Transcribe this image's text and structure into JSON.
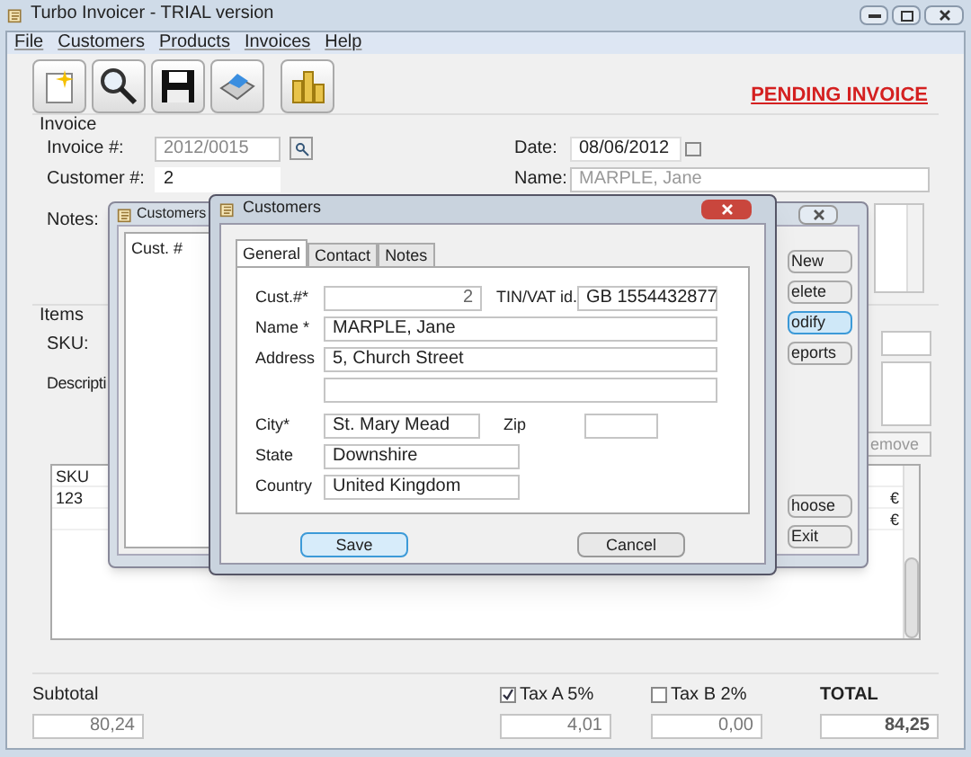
{
  "window": {
    "title": "Turbo Invoicer - TRIAL version"
  },
  "menu": [
    "File",
    "Customers",
    "Products",
    "Invoices",
    "Help"
  ],
  "status_label": "PENDING INVOICE",
  "invoice": {
    "title": "Invoice",
    "invoice_label": "Invoice #:",
    "invoice_value": "2012/0015",
    "customer_label": "Customer #:",
    "customer_value": "2",
    "notes_label": "Notes:",
    "date_label": "Date:",
    "date_value": "08/06/2012",
    "name_label": "Name:",
    "name_value": "MARPLE, Jane"
  },
  "items": {
    "title": "Items",
    "sku_label": "SKU:",
    "description_label": "Descripti",
    "remove_button": "emove",
    "table": {
      "columns": [
        "SKU"
      ],
      "rows": [
        {
          "sku": "123",
          "column_2": "€"
        },
        {
          "column_2": "€"
        }
      ]
    }
  },
  "totals": {
    "subtotal_label": "Subtotal",
    "subtotal": "80,24",
    "taxes": [
      {
        "label": "Tax A 5%",
        "checked": true,
        "value": "4,01"
      },
      {
        "label": "Tax B 2%",
        "checked": false,
        "value": "0,00"
      }
    ],
    "total_label": "TOTAL",
    "total": "84,25"
  },
  "customers_list": {
    "title": "Customers",
    "columns": [
      "Cust. #"
    ],
    "buttons": [
      {
        "label": "New",
        "focused": false
      },
      {
        "label": "elete",
        "focused": false
      },
      {
        "label": "odify",
        "focused": true
      },
      {
        "label": "eports",
        "focused": false
      },
      {
        "label": "hoose",
        "focused": false
      },
      {
        "label": "Exit",
        "focused": false
      }
    ]
  },
  "customer_dialog": {
    "title": "Customers",
    "tabs": [
      {
        "label": "General",
        "selected": true
      },
      {
        "label": "Contact",
        "selected": false
      },
      {
        "label": "Notes",
        "selected": false
      }
    ],
    "cust_label": "Cust.#*",
    "cust_value": "2",
    "tin_label": "TIN/VAT id.",
    "tin_value": "GB 1554432877",
    "name_label": "Name *",
    "name_value": "MARPLE, Jane",
    "address_label": "Address",
    "address_line_1": "5, Church Street",
    "city_label": "City*",
    "city_value": "St. Mary Mead",
    "zip_label": "Zip",
    "state_label": "State",
    "state_value": "Downshire",
    "country_label": "Country",
    "country_value": "United Kingdom",
    "save": "Save",
    "cancel": "Cancel"
  }
}
